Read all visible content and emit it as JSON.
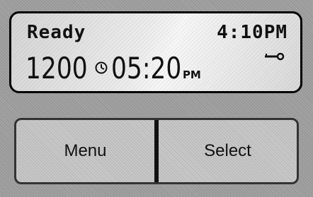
{
  "display": {
    "status": "Ready",
    "clock": "4:10PM",
    "counter": "1200",
    "time": "05:20",
    "ampm": "PM"
  },
  "icons": {
    "lock": "key-icon",
    "timer": "timer-icon"
  },
  "buttons": {
    "menu_label": "Menu",
    "select_label": "Select"
  }
}
